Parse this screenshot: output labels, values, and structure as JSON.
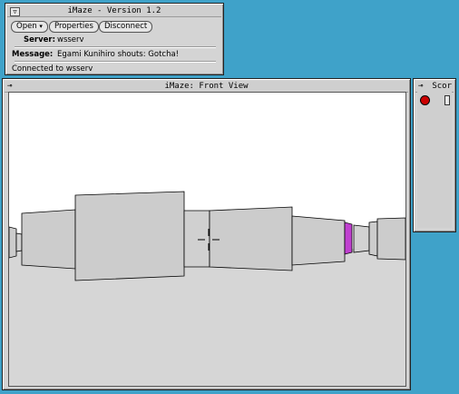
{
  "control_window": {
    "title": "iMaze - Version 1.2",
    "buttons": {
      "open": "Open",
      "properties": "Properties",
      "disconnect": "Disconnect"
    },
    "server_label": "Server:",
    "server_value": "wsserv",
    "message_label": "Message:",
    "message_value": "Egami Kunihiro shouts: Gotcha!",
    "status": "Connected to wsserv"
  },
  "front_view": {
    "title": "iMaze: Front View"
  },
  "score_window": {
    "title": "Scor"
  },
  "colors": {
    "desktop": "#3fa2c9",
    "window": "#d4d4d4",
    "floor": "#d6d6d6",
    "sky": "#ffffff",
    "wall": "#cccccc",
    "player_marker": "#c040d0",
    "score_dot": "#cc0000"
  },
  "icons": [
    "window-menu-icon",
    "pushpin-icon",
    "dropdown-arrow-icon",
    "crosshair-icon",
    "red-player-dot-icon"
  ]
}
